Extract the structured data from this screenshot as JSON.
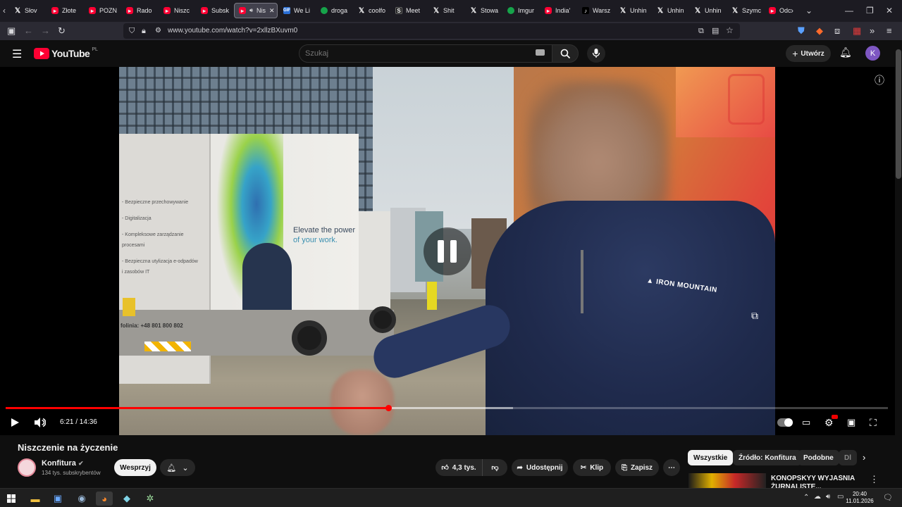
{
  "browser": {
    "tabs": [
      {
        "title": "Słov",
        "icon": "x-icon"
      },
      {
        "title": "Złote",
        "icon": "youtube-icon"
      },
      {
        "title": "POZN",
        "icon": "youtube-icon"
      },
      {
        "title": "Rado",
        "icon": "youtube-icon"
      },
      {
        "title": "Niszc",
        "icon": "youtube-icon"
      },
      {
        "title": "Subsk",
        "icon": "youtube-icon"
      },
      {
        "title": "Nis",
        "icon": "youtube-icon",
        "active": true
      },
      {
        "title": "We Li",
        "icon": "gif-icon"
      },
      {
        "title": "droga",
        "icon": "green-icon"
      },
      {
        "title": "coolfo",
        "icon": "x-icon"
      },
      {
        "title": "Meet",
        "icon": "s-icon"
      },
      {
        "title": "Shit",
        "icon": "x-icon"
      },
      {
        "title": "Stowa",
        "icon": "x-icon"
      },
      {
        "title": "Imgur",
        "icon": "green-icon"
      },
      {
        "title": "India'",
        "icon": "youtube-icon"
      },
      {
        "title": "Warsz",
        "icon": "tiktok-icon"
      },
      {
        "title": "Unhin",
        "icon": "x-icon"
      },
      {
        "title": "Unhin",
        "icon": "x-icon"
      },
      {
        "title": "Unhin",
        "icon": "x-icon"
      },
      {
        "title": "Szymc",
        "icon": "x-icon"
      },
      {
        "title": "Odc",
        "icon": "youtube-icon"
      }
    ],
    "url": "www.youtube.com/watch?v=2xllzBXuvm0"
  },
  "youtube": {
    "logo": "YouTube",
    "region": "PL",
    "search_placeholder": "Szukaj",
    "create_label": "Utwórz",
    "avatar_letter": "K"
  },
  "player": {
    "current_time": "6:21",
    "duration": "14:36",
    "progress_fraction": 0.434,
    "time_display": "6:21 / 14:36",
    "video_text": {
      "truck_list": [
        "- Bezpieczne przechowywanie",
        "- Digitalizacja",
        "- Kompleksowe zarządzanie procesami",
        "- Bezpieczna utylizacja e-odpadów i zasobów IT"
      ],
      "truck_slogan_1": "Elevate the power",
      "truck_slogan_2": "of your work.",
      "truck_phone": "folinia: +48 801 800 802",
      "jacket_logo": "IRON MOUNTAIN"
    }
  },
  "video": {
    "title": "Niszczenie na życzenie",
    "channel": "Konfitura",
    "subscribers": "134 tys. subskrybentów",
    "support_label": "Wesprzyj",
    "likes": "4,3 tys.",
    "share_label": "Udostępnij",
    "clip_label": "Klip",
    "save_label": "Zapisz"
  },
  "chips": [
    "Wszystkie",
    "Źródło: Konfitura",
    "Podobne",
    "Dl"
  ],
  "recommendation": {
    "title": "KONOPSKYY WYJAŚNIA ŻURNALISTE..."
  },
  "taskbar": {
    "time": "20:40",
    "date": "11.01.2026"
  },
  "colors": {
    "accent_red": "#ff0000",
    "background": "#0f0f0f"
  }
}
